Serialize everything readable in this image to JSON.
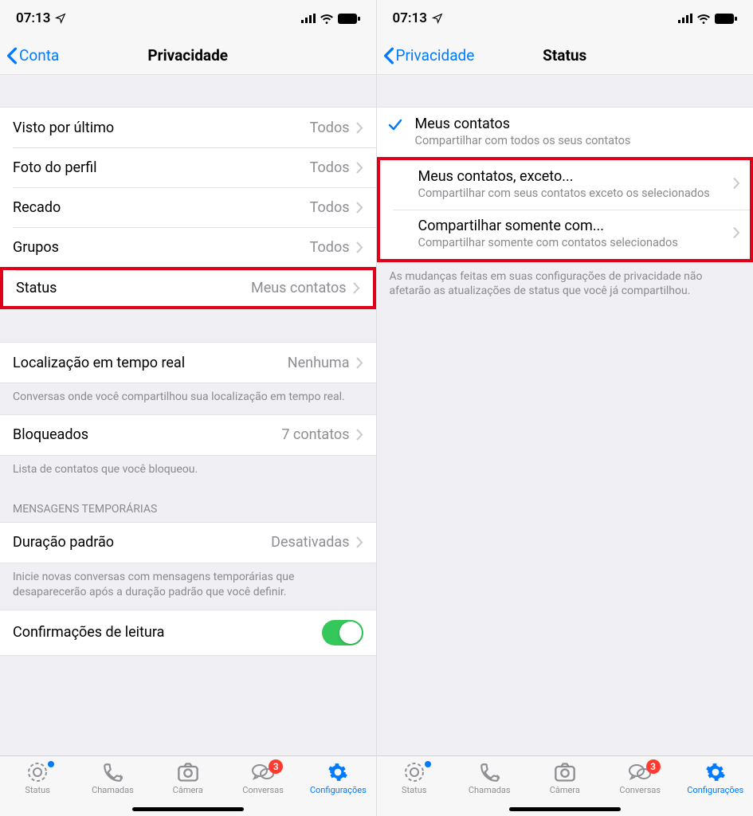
{
  "status": {
    "time": "07:13"
  },
  "left": {
    "back": "Conta",
    "title": "Privacidade",
    "rows": {
      "last_seen_label": "Visto por último",
      "last_seen_value": "Todos",
      "photo_label": "Foto do perfil",
      "photo_value": "Todos",
      "about_label": "Recado",
      "about_value": "Todos",
      "groups_label": "Grupos",
      "groups_value": "Todos",
      "status_label": "Status",
      "status_value": "Meus contatos",
      "location_label": "Localização em tempo real",
      "location_value": "Nenhuma",
      "location_footer": "Conversas onde você compartilhou sua localização em tempo real.",
      "blocked_label": "Bloqueados",
      "blocked_value": "7 contatos",
      "blocked_footer": "Lista de contatos que você bloqueou.",
      "temp_header": "MENSAGENS TEMPORÁRIAS",
      "duration_label": "Duração padrão",
      "duration_value": "Desativadas",
      "duration_footer": "Inicie novas conversas com mensagens temporárias que desaparecerão após a duração padrão que você definir.",
      "read_label": "Confirmações de leitura"
    }
  },
  "right": {
    "back": "Privacidade",
    "title": "Status",
    "opt1_title": "Meus contatos",
    "opt1_sub": "Compartilhar com todos os seus contatos",
    "opt2_title": "Meus contatos, exceto...",
    "opt2_sub": "Compartilhar com seus contatos exceto os selecionados",
    "opt3_title": "Compartilhar somente com...",
    "opt3_sub": "Compartilhar somente com contatos selecionados",
    "footer": "As mudanças feitas em suas configurações de privacidade não afetarão as atualizações de status que você já compartilhou."
  },
  "tabs": {
    "status": "Status",
    "calls": "Chamadas",
    "camera": "Câmera",
    "chats": "Conversas",
    "settings": "Configurações",
    "badge": "3"
  }
}
